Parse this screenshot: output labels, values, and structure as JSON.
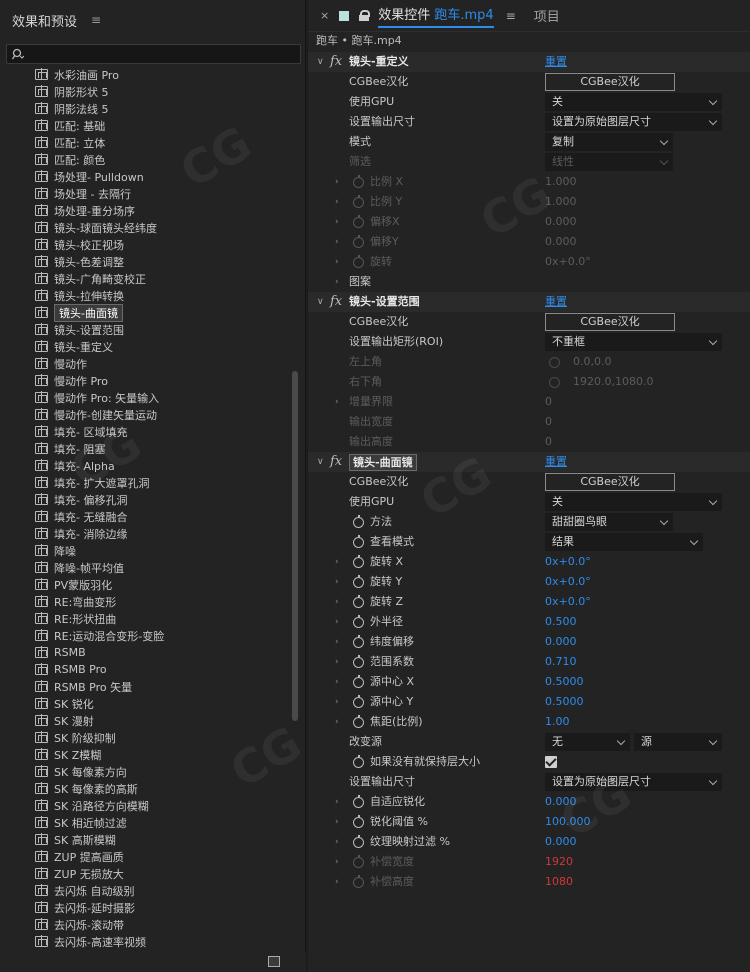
{
  "left_panel": {
    "title": "效果和预设",
    "menu_icon": "≡",
    "search": {
      "value": "",
      "placeholder": ""
    },
    "items": [
      "水彩油画 Pro",
      "阴影形状 5",
      "阴影法线 5",
      "匹配: 基础",
      "匹配: 立体",
      "匹配: 颜色",
      "场处理- Pulldown",
      "场处理 - 去隔行",
      "场处理-重分场序",
      "镜头-球面镜头经纬度",
      "镜头-校正视场",
      "镜头-色差调整",
      "镜头-广角畸变校正",
      "镜头-拉伸转换",
      "镜头-曲面镜",
      "镜头-设置范围",
      "镜头-重定义",
      "慢动作",
      "慢动作 Pro",
      "慢动作 Pro: 矢量输入",
      "慢动作-创建矢量运动",
      "填充- 区域填充",
      "填充- 阻塞",
      "填充- Alpha",
      "填充- 扩大遮罩孔洞",
      "填充- 偏移孔洞",
      "填充- 无缝融合",
      "填充- 消除边缘",
      "降噪",
      "降噪-帧平均值",
      "PV蒙版羽化",
      "RE:弯曲变形",
      "RE:形状扭曲",
      "RE:运动混合变形-变脸",
      "RSMB",
      "RSMB Pro",
      "RSMB Pro 矢量",
      "SK 锐化",
      "SK 漫射",
      "SK 阶级抑制",
      "SK Z模糊",
      "SK 每像素方向",
      "SK 每像素的高斯",
      "SK 沿路径方向模糊",
      "SK 相近帧过滤",
      "SK 高斯模糊",
      "ZUP 提高画质",
      "ZUP 无损放大",
      "去闪烁 自动级别",
      "去闪烁-延时摄影",
      "去闪烁-滚动带",
      "去闪烁-高速率视频"
    ],
    "selected_index": 14
  },
  "right_panel": {
    "tab_close": "×",
    "tab_title_prefix": "效果控件",
    "tab_title_file": "跑车.mp4",
    "tab_menu": "≡",
    "tab_project": "项目",
    "breadcrumb": "跑车 • 跑车.mp4",
    "reset_label": "重置",
    "cgbee_btn": "CGBee汉化",
    "sections": [
      {
        "title": "镜头-重定义",
        "rows": [
          {
            "name": "CGBee汉化",
            "type": "button"
          },
          {
            "name": "使用GPU",
            "type": "dropdown",
            "value": "关"
          },
          {
            "name": "设置输出尺寸",
            "type": "dropdown",
            "value": "设置为原始图层尺寸"
          },
          {
            "name": "模式",
            "type": "dropdown",
            "value": "复制"
          },
          {
            "name": "筛选",
            "type": "dropdown",
            "value": "线性",
            "dim": true
          },
          {
            "name": "比例 X",
            "value": "1.000",
            "dim": true,
            "twirl": true,
            "stopwatch": true
          },
          {
            "name": "比例 Y",
            "value": "1.000",
            "dim": true,
            "twirl": true,
            "stopwatch": true
          },
          {
            "name": "偏移X",
            "value": "0.000",
            "dim": true,
            "twirl": true,
            "stopwatch": true
          },
          {
            "name": "偏移Y",
            "value": "0.000",
            "dim": true,
            "twirl": true,
            "stopwatch": true
          },
          {
            "name": "旋转",
            "value": "0x+0.0°",
            "dim": true,
            "twirl": true,
            "stopwatch": true
          },
          {
            "name": "图案",
            "twirl": true
          }
        ]
      },
      {
        "title": "镜头-设置范围",
        "rows": [
          {
            "name": "CGBee汉化",
            "type": "button"
          },
          {
            "name": "设置输出矩形(ROI)",
            "type": "dropdown",
            "value": "不重框"
          },
          {
            "name": "左上角",
            "value": "0.0,0.0",
            "dim": true,
            "target": true
          },
          {
            "name": "右下角",
            "value": "1920.0,1080.0",
            "dim": true,
            "target": true
          },
          {
            "name": "增量界限",
            "value": "0",
            "dim": true,
            "twirl": true
          },
          {
            "name": "输出宽度",
            "value": "0",
            "dim": true
          },
          {
            "name": "输出高度",
            "value": "0",
            "dim": true
          }
        ]
      },
      {
        "title": "镜头-曲面镜",
        "selected": true,
        "rows": [
          {
            "name": "CGBee汉化",
            "type": "button"
          },
          {
            "name": "使用GPU",
            "type": "dropdown",
            "value": "关"
          },
          {
            "name": "方法",
            "type": "dropdown",
            "value": "甜甜圈鸟眼",
            "stopwatch": true
          },
          {
            "name": "查看模式",
            "type": "dropdown",
            "value": "结果",
            "stopwatch": true
          },
          {
            "name": "旋转 X",
            "value": "0x+0.0°",
            "twirl": true,
            "stopwatch": true
          },
          {
            "name": "旋转 Y",
            "value": "0x+0.0°",
            "twirl": true,
            "stopwatch": true
          },
          {
            "name": "旋转 Z",
            "value": "0x+0.0°",
            "twirl": true,
            "stopwatch": true
          },
          {
            "name": "外半径",
            "value": "0.500",
            "twirl": true,
            "stopwatch": true
          },
          {
            "name": "纬度偏移",
            "value": "0.000",
            "twirl": true,
            "stopwatch": true
          },
          {
            "name": "范围系数",
            "value": "0.710",
            "twirl": true,
            "stopwatch": true
          },
          {
            "name": "源中心 X",
            "value": "0.5000",
            "twirl": true,
            "stopwatch": true
          },
          {
            "name": "源中心 Y",
            "value": "0.5000",
            "twirl": true,
            "stopwatch": true
          },
          {
            "name": "焦距(比例)",
            "value": "1.00",
            "twirl": true,
            "stopwatch": true
          },
          {
            "name": "改变源",
            "type": "dual-dropdown",
            "value": "无",
            "value2": "源"
          },
          {
            "name": "如果没有就保持层大小",
            "type": "checkbox",
            "checked": true,
            "stopwatch": true
          },
          {
            "name": "设置输出尺寸",
            "type": "dropdown",
            "value": "设置为原始图层尺寸"
          },
          {
            "name": "自适应锐化",
            "value": "0.000",
            "twirl": true,
            "stopwatch": true
          },
          {
            "name": "锐化阈值 %",
            "value": "100.000",
            "twirl": true,
            "stopwatch": true
          },
          {
            "name": "纹理映射过滤 %",
            "value": "0.000",
            "twirl": true,
            "stopwatch": true
          },
          {
            "name": "补偿宽度",
            "value": "1920",
            "dim": true,
            "red": true,
            "twirl": true,
            "stopwatch": true
          },
          {
            "name": "补偿高度",
            "value": "1080",
            "dim": true,
            "red": true,
            "twirl": true,
            "stopwatch": true
          }
        ]
      }
    ]
  },
  "colors": {
    "accent": "#2d8ceb",
    "panel": "#232323",
    "warning": "#d13838"
  }
}
